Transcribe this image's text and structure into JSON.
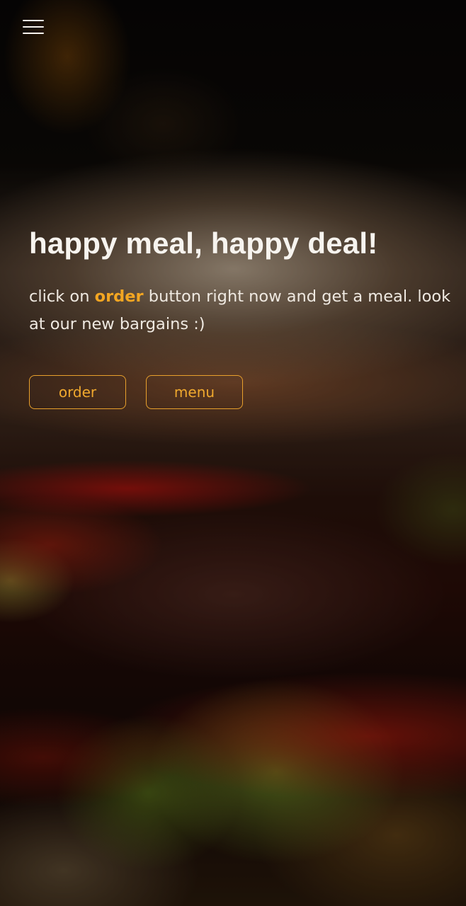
{
  "nav": {
    "menu_icon": "hamburger-menu-icon"
  },
  "hero": {
    "title": "happy meal, happy deal!",
    "text_before": "click on ",
    "text_highlight": "order",
    "text_after": " button right now and get a meal. look at our new bargains :)"
  },
  "actions": {
    "order_label": "order",
    "menu_label": "menu"
  },
  "colors": {
    "accent": "#f3a622",
    "text": "#f7f4ef"
  }
}
